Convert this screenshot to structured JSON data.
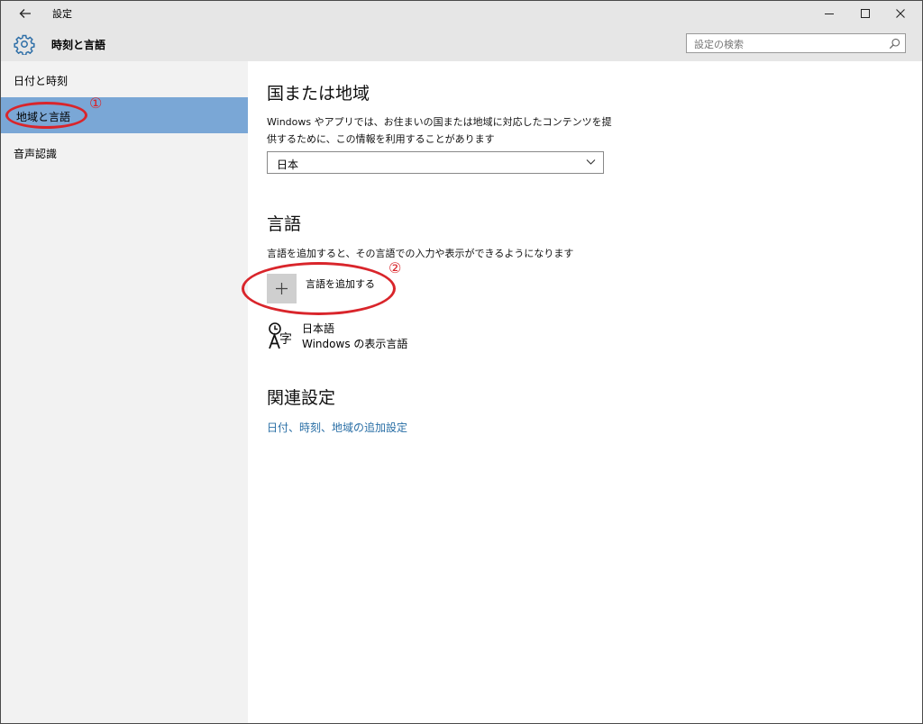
{
  "window": {
    "title": "設定",
    "icons": [
      "back-arrow-icon",
      "minimize-icon",
      "maximize-icon",
      "close-icon"
    ]
  },
  "header": {
    "page_title": "時刻と言語",
    "icon": "gear-icon"
  },
  "search": {
    "placeholder": "設定の検索",
    "icon": "search-icon"
  },
  "sidebar": {
    "items": [
      {
        "label": "日付と時刻",
        "selected": false
      },
      {
        "label": "地域と言語",
        "selected": true
      },
      {
        "label": "音声認識",
        "selected": false
      }
    ]
  },
  "main": {
    "region": {
      "heading": "国または地域",
      "desc_line1": "Windows やアプリでは、お住まいの国または地域に対応したコンテンツを提",
      "desc_line2": "供するために、この情報を利用することがあります",
      "selected_value": "日本"
    },
    "language": {
      "heading": "言語",
      "desc": "言語を追加すると、その言語での入力や表示ができるようになります",
      "add_button_label": "言語を追加する",
      "languages": [
        {
          "name": "日本語",
          "sub": "Windows の表示言語",
          "icon": "language-icon"
        }
      ]
    },
    "related": {
      "heading": "関連設定",
      "link": "日付、時刻、地域の追加設定"
    }
  },
  "annotations": {
    "marker1": "①",
    "marker2": "②",
    "color": "#d9252b"
  },
  "colors": {
    "selected_nav": "#7aa7d6",
    "link": "#2a6fa6",
    "chrome": "#e6e6e6",
    "sidebar": "#f2f2f2"
  }
}
